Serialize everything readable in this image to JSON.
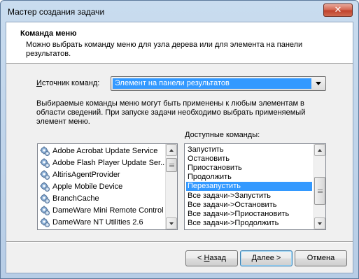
{
  "window": {
    "title": "Мастер создания задачи",
    "close_label": "✕"
  },
  "header": {
    "title": "Команда меню",
    "description": "Можно выбрать команду меню для узла дерева или для элемента на панели результатов."
  },
  "source": {
    "label_prefix": "",
    "label_accel": "И",
    "label_rest": "сточник команд:",
    "selected": "Элемент на панели результатов"
  },
  "info_text": "Выбираемые команды меню могут быть применены к любым элементам в области сведений. При запуске задачи необходимо выбрать применяемый элемент меню.",
  "commands_label": {
    "accel": "Д",
    "rest": "оступные команды:"
  },
  "services": {
    "icon": "service-gear-icon",
    "items": [
      "Adobe Acrobat Update Service",
      "Adobe Flash Player Update Ser...",
      "AltirisAgentProvider",
      "Apple Mobile Device",
      "BranchCache",
      "DameWare Mini Remote Control",
      "DameWare NT Utilities 2.6"
    ]
  },
  "commands": {
    "items": [
      "Запустить",
      "Остановить",
      "Приостановить",
      "Продолжить",
      "Перезапустить",
      "Все задачи->Запустить",
      "Все задачи->Остановить",
      "Все задачи->Приостановить",
      "Все задачи->Продолжить"
    ],
    "selected_index": 4
  },
  "buttons": {
    "back_prefix": "< ",
    "back_accel": "Н",
    "back_rest": "азад",
    "next_accel": "Д",
    "next_rest": "алее >",
    "cancel": "Отмена"
  },
  "colors": {
    "selection": "#3399ff",
    "titlebar": "#c9dcef",
    "close": "#c0422c"
  }
}
